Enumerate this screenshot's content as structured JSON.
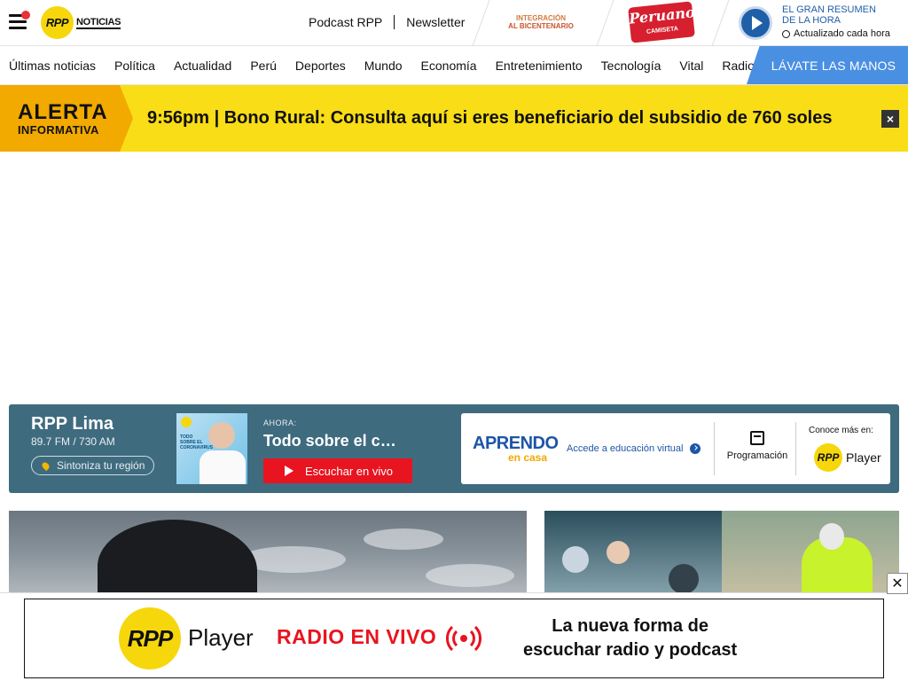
{
  "header": {
    "logo_mark": "RPP",
    "logo_word": "NOTICIAS",
    "links": [
      "Podcast RPP",
      "Newsletter"
    ],
    "bicentenario_l1": "INTEGRACIÓN",
    "bicentenario_l2": "AL BICENTENARIO",
    "peruanos_title": "Peruanos",
    "peruanos_sub": "CAMISETA",
    "resumen_title": "EL GRAN RESUMEN DE LA HORA",
    "resumen_updated": "Actualizado cada hora"
  },
  "nav": {
    "items": [
      "Últimas noticias",
      "Política",
      "Actualidad",
      "Perú",
      "Deportes",
      "Mundo",
      "Economía",
      "Entretenimiento",
      "Tecnología",
      "Vital",
      "Radio"
    ],
    "cta": "LÁVATE LAS MANOS"
  },
  "alert": {
    "label_main": "ALERTA",
    "label_sub": "INFORMATIVA",
    "text": "9:56pm | Bono Rural: Consulta aquí si eres beneficiario del subsidio de 760 soles",
    "close": "×"
  },
  "radio": {
    "name": "RPP Lima",
    "frequency": "89.7 FM / 730 AM",
    "region_button": "Sintoniza tu región",
    "thumb_logo": "RPP",
    "thumb_text": "TODO SOBRE EL CORONAVIRUS",
    "now_label": "AHORA:",
    "program": "Todo sobre el coronavirus",
    "listen_button": "Escuchar en vivo"
  },
  "card": {
    "aprendo_line1": "APRENDO",
    "aprendo_line2": "en casa",
    "aprendo_dots": "• • • •",
    "accede": "Accede a educación virtual",
    "programacion": "Programación",
    "conoce": "Conoce más en:",
    "player_mark": "RPP",
    "player_word": "Player"
  },
  "ad": {
    "mark": "RPP",
    "player_word": "Player",
    "live": "RADIO EN VIVO",
    "slogan_l1": "La nueva forma de",
    "slogan_l2": "escuchar radio y podcast",
    "close": "✕"
  },
  "colors": {
    "brand_yellow": "#f6d70c",
    "alert_yellow": "#f9dd16",
    "alert_orange": "#f2a900",
    "radio_bg": "#3f6b7f",
    "live_red": "#e8141f",
    "cta_blue": "#4a90e2"
  }
}
